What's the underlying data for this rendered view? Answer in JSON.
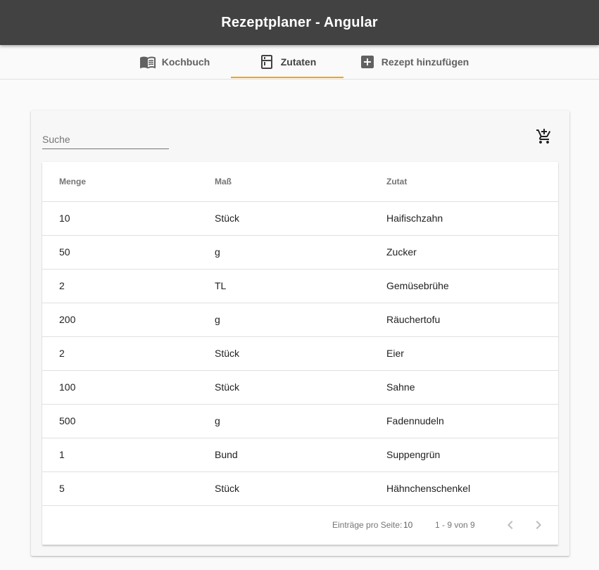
{
  "app": {
    "title": "Rezeptplaner - Angular"
  },
  "tabs": [
    {
      "label": "Kochbuch",
      "icon": "menu-book-icon"
    },
    {
      "label": "Zutaten",
      "icon": "kitchen-icon"
    },
    {
      "label": "Rezept hinzufügen",
      "icon": "add-box-icon"
    }
  ],
  "colors": {
    "toolbar": "#424242",
    "tab_ink": "#ffa000"
  },
  "search": {
    "placeholder": "Suche",
    "value": ""
  },
  "actions": {
    "add_to_cart_icon": "add-shopping-cart-icon"
  },
  "table": {
    "columns": [
      "Menge",
      "Maß",
      "Zutat"
    ],
    "rows": [
      [
        "10",
        "Stück",
        "Haifischzahn"
      ],
      [
        "50",
        "g",
        "Zucker"
      ],
      [
        "2",
        "TL",
        "Gemüsebrühe"
      ],
      [
        "200",
        "g",
        "Räuchertofu"
      ],
      [
        "2",
        "Stück",
        "Eier"
      ],
      [
        "100",
        "Stück",
        "Sahne"
      ],
      [
        "500",
        "g",
        "Fadennudeln"
      ],
      [
        "1",
        "Bund",
        "Suppengrün"
      ],
      [
        "5",
        "Stück",
        "Hähnchenschenkel"
      ]
    ]
  },
  "paginator": {
    "items_per_page_label": "Einträge pro Seite:",
    "page_size": "10",
    "range_label": "1 - 9 von 9"
  }
}
